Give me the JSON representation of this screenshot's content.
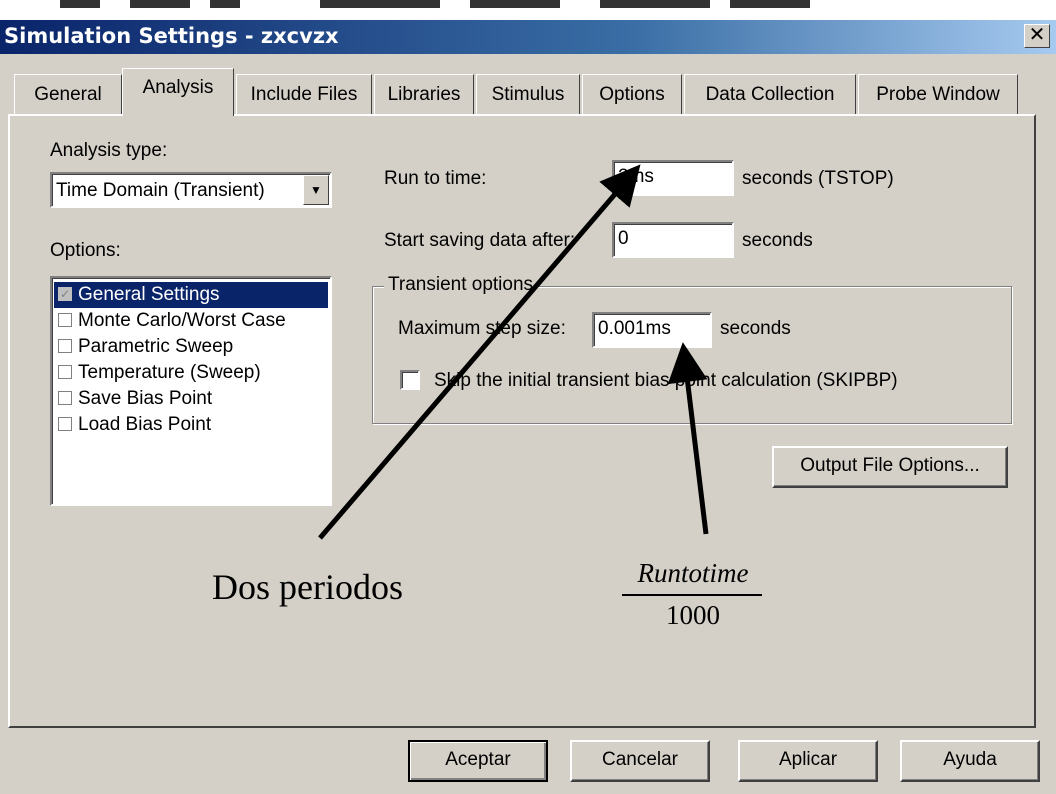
{
  "window": {
    "title": "Simulation Settings - zxcvzx",
    "close_glyph": "✕"
  },
  "tabs": [
    {
      "label": "General"
    },
    {
      "label": "Analysis",
      "active": true
    },
    {
      "label": "Include Files"
    },
    {
      "label": "Libraries"
    },
    {
      "label": "Stimulus"
    },
    {
      "label": "Options"
    },
    {
      "label": "Data Collection"
    },
    {
      "label": "Probe Window"
    }
  ],
  "analysis": {
    "type_label": "Analysis type:",
    "type_value": "Time Domain (Transient)",
    "options_label": "Options:",
    "options": [
      {
        "label": "General Settings",
        "checked": true,
        "selected": true
      },
      {
        "label": "Monte Carlo/Worst Case",
        "checked": false
      },
      {
        "label": "Parametric Sweep",
        "checked": false
      },
      {
        "label": "Temperature (Sweep)",
        "checked": false
      },
      {
        "label": "Save Bias Point",
        "checked": false
      },
      {
        "label": "Load Bias Point",
        "checked": false
      }
    ]
  },
  "run_to_time": {
    "label": "Run to time:",
    "value": "2ms",
    "unit": "seconds  (TSTOP)"
  },
  "start_saving": {
    "label": "Start saving data after:",
    "value": "0",
    "unit": "seconds"
  },
  "transient_options": {
    "title": "Transient options",
    "max_step_label": "Maximum step size:",
    "max_step_value": "0.001ms",
    "max_step_unit": "seconds",
    "skip_label": "Skip the initial transient bias point calculation  (SKIPBP)",
    "skip_checked": false
  },
  "output_file_button": "Output File Options...",
  "annotations": {
    "left_text": "Dos periodos",
    "fraction_numerator": "Runtotime",
    "fraction_denominator": "1000"
  },
  "footer": {
    "ok": "Aceptar",
    "cancel": "Cancelar",
    "apply": "Aplicar",
    "help": "Ayuda"
  },
  "colors": {
    "title_bar": "#0a246a",
    "dialog_bg": "#d4d0c8",
    "selection": "#0a246a"
  }
}
